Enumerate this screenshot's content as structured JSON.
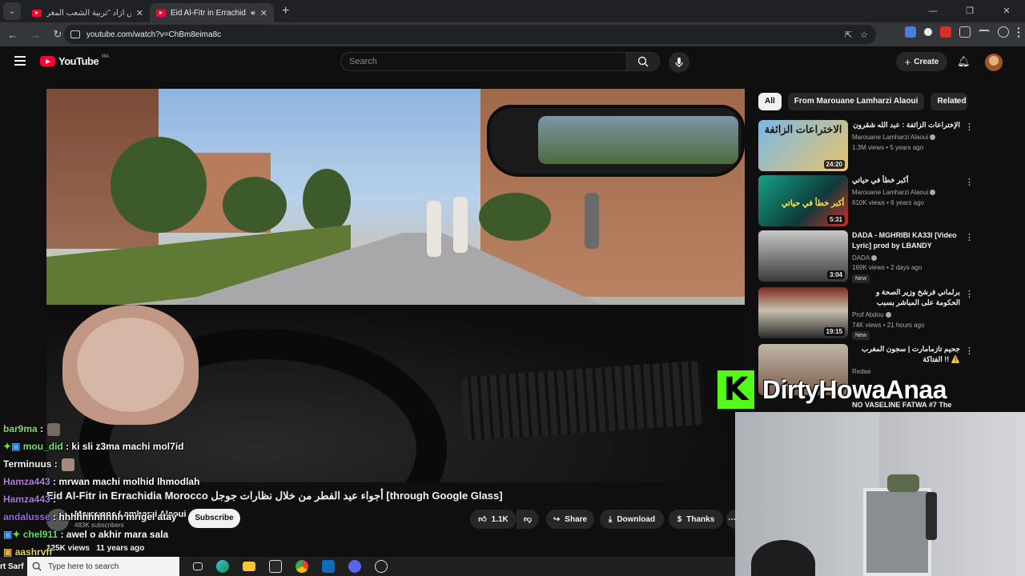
{
  "browser": {
    "tabs": [
      {
        "title": "اخوش أزاد \"تربية الشعب المغر...",
        "active": false
      },
      {
        "title": "Eid Al-Fitr in Errachidia Mo",
        "active": true
      }
    ],
    "new_tab": "+",
    "url": "youtube.com/watch?v=ChBm8eima8c",
    "window_controls": [
      "—",
      "❐",
      "✕"
    ]
  },
  "youtube": {
    "logo_text": "YouTube",
    "country_code": "MA",
    "search_placeholder": "Search",
    "create_label": "Create"
  },
  "video": {
    "title": "Eid Al-Fitr in Errachidia Morocco أجواء عيد الفطر من خلال نظارات جوجل [through Google Glass]",
    "channel": "Marouane Lamharzi Alaoui",
    "subscribers": "483K subscribers",
    "subscribe_label": "Subscribe",
    "likes": "1.1K",
    "share_label": "Share",
    "download_label": "Download",
    "thanks_label": "Thanks",
    "views": "125K views",
    "age": "11 years ago"
  },
  "sidebar": {
    "chips": [
      "All",
      "From Marouane Lamharzi Alaoui",
      "Related"
    ],
    "recommendations": [
      {
        "title": "الإختراعات الزائفة : عبد الله شقرون",
        "channel": "Marouane Lamharzi Alaoui",
        "verified": true,
        "views": "1.3M views",
        "age": "5 years ago",
        "duration": "24:20",
        "new": false,
        "thumb_text": "الاختراعات الزائفة"
      },
      {
        "title": "أكبر خطأ في حياتي",
        "channel": "Marouane Lamharzi Alaoui",
        "verified": true,
        "views": "610K views",
        "age": "6 years ago",
        "duration": "5:31",
        "new": false,
        "thumb_text": "أكبر خطأ في حياتي"
      },
      {
        "title": "DADA - MGHRIBI KA33I [Video Lyric] prod by LBANDY",
        "channel": "DADA",
        "verified": true,
        "views": "169K views",
        "age": "2 days ago",
        "duration": "3:04",
        "new": true,
        "thumb_text": ""
      },
      {
        "title": "برلماني فرشخ وزير الصحة و الحكومة على المباشر بسبب احتجاجات الشباب، حكومة ...",
        "channel": "Prof Abdou",
        "verified": true,
        "views": "74K views",
        "age": "21 hours ago",
        "duration": "19:15",
        "new": true,
        "thumb_text": ""
      },
      {
        "title": "جحيم تازمامارت | سجون المغرب الفتاكة !! ⚠️",
        "channel": "Redae",
        "verified": false,
        "views": "",
        "age": "",
        "duration": "",
        "new": false,
        "thumb_text": ""
      },
      {
        "title": "NO VASELINE FATWA #7 The",
        "channel": "",
        "verified": false,
        "views": "",
        "age": "",
        "duration": "",
        "new": false,
        "thumb_text": ""
      }
    ],
    "new_badge": "New"
  },
  "stream": {
    "kick_logo": "K",
    "streamer": "DirtyHowaAnaa",
    "chat": [
      {
        "user": "bar9ma",
        "sep": " : ",
        "message": ""
      },
      {
        "user": "mou_did",
        "sep": " : ",
        "message": "ki sli z3ma machi mol7id"
      },
      {
        "user": "Terminuus",
        "sep": " : ",
        "message": ""
      },
      {
        "user": "Hamza443",
        "sep": " : ",
        "message": "mrwan machi molhid lhmodlah"
      },
      {
        "user": "Hamza443",
        "sep": " : ",
        "message": ""
      },
      {
        "user": "andalusse",
        "sep": " : ",
        "message": "hhhhhhhhhhh mrigel atay"
      },
      {
        "user": "chel911",
        "sep": " : ",
        "message": "awel o akhir mara sala"
      },
      {
        "user": "aashrvff",
        "sep": "",
        "message": ""
      }
    ]
  },
  "taskbar": {
    "start_text": "rt Sarf",
    "search_placeholder": "Type here to search"
  },
  "colors": {
    "youtube_red": "#ff0033",
    "kick_green": "#53fc18",
    "background": "#0f0f0f"
  }
}
